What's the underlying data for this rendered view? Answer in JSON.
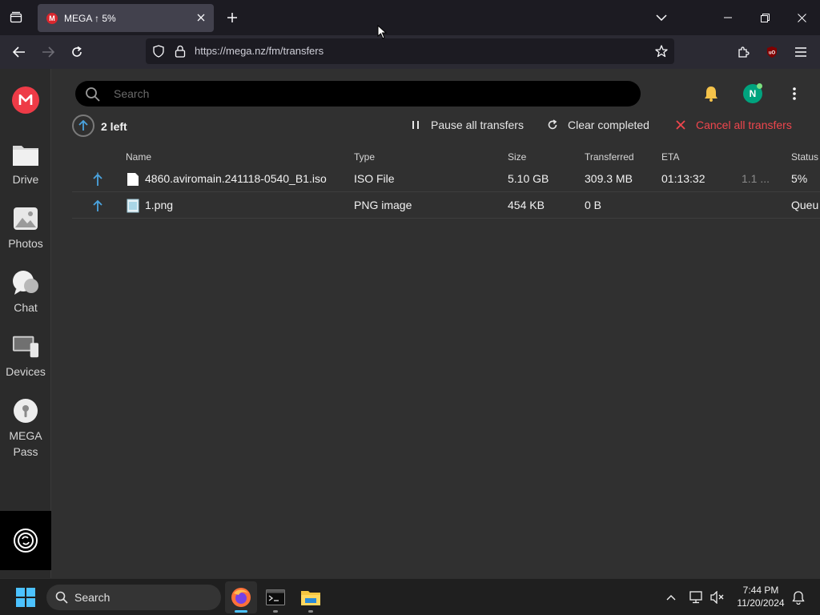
{
  "browser": {
    "tab": {
      "title": "MEGA ↑ 5%",
      "favicon": "M"
    },
    "url": "https://mega.nz/fm/transfers"
  },
  "sidebar": {
    "items": [
      {
        "label": "Drive",
        "icon": "folder-icon"
      },
      {
        "label": "Photos",
        "icon": "photos-icon"
      },
      {
        "label": "Chat",
        "icon": "chat-icon"
      },
      {
        "label": "Devices",
        "icon": "devices-icon"
      },
      {
        "label": "MEGA Pass",
        "icon": "mega-pass-icon"
      }
    ]
  },
  "topbar": {
    "search_placeholder": "Search",
    "avatar_initial": "N"
  },
  "transfers": {
    "remaining": "2 left",
    "pause_all": "Pause all transfers",
    "clear_completed": "Clear completed",
    "cancel_all": "Cancel all transfers",
    "columns": [
      "Name",
      "Type",
      "Size",
      "Transferred",
      "ETA",
      "Status"
    ],
    "rows": [
      {
        "name": "4860.aviromain.241118-0540_B1.iso",
        "type": "ISO File",
        "size": "5.10 GB",
        "transferred": "309.3 MB",
        "eta": "01:13:32",
        "speed": "1.1 ...",
        "status": "5%"
      },
      {
        "name": "1.png",
        "type": "PNG image",
        "size": "454 KB",
        "transferred": "0 B",
        "eta": "",
        "speed": "",
        "status": "Queu"
      }
    ]
  },
  "taskbar": {
    "search": "Search",
    "time": "7:44 PM",
    "date": "11/20/2024"
  },
  "colors": {
    "accent": "#ee3b47",
    "cancel": "#f0464d",
    "upload_arrow": "#4aa3df"
  }
}
